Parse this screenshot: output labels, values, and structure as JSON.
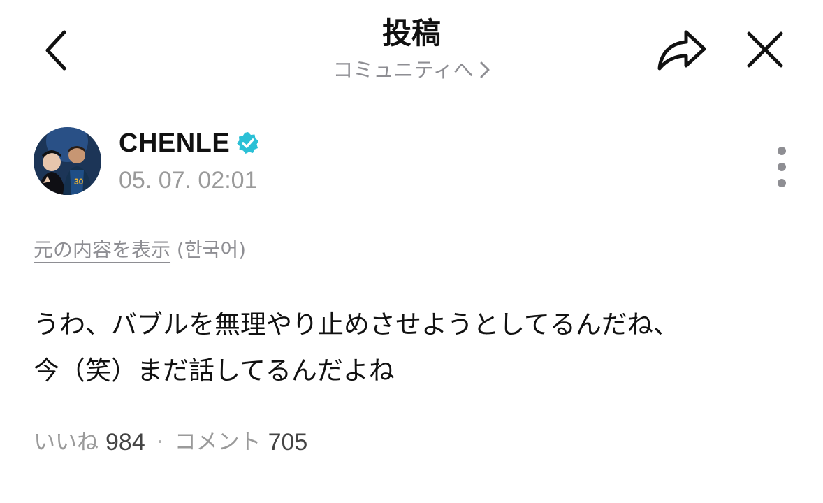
{
  "header": {
    "title": "投稿",
    "community_link": "コミュニティへ",
    "chevron_glyph": "›"
  },
  "author": {
    "name": "CHENLE",
    "timestamp": "05. 07. 02:01",
    "verified": true
  },
  "translation": {
    "show_original": "元の内容を表示",
    "language": "(한국어)"
  },
  "post": {
    "text": "うわ、バブルを無理やり止めさせようとしてるんだね、\n今（笑）まだ話してるんだよね"
  },
  "stats": {
    "likes_label": "いいね",
    "likes_count": "984",
    "separator": "·",
    "comments_label": "コメント",
    "comments_count": "705"
  },
  "colors": {
    "text_primary": "#111111",
    "text_secondary": "#8e8e93",
    "verified_badge": "#2bc0d6",
    "background": "#ffffff"
  },
  "icons": {
    "back": "chevron-left-icon",
    "share": "share-arrow-icon",
    "close": "close-x-icon",
    "more": "more-vertical-icon",
    "verified": "verified-badge-icon"
  }
}
